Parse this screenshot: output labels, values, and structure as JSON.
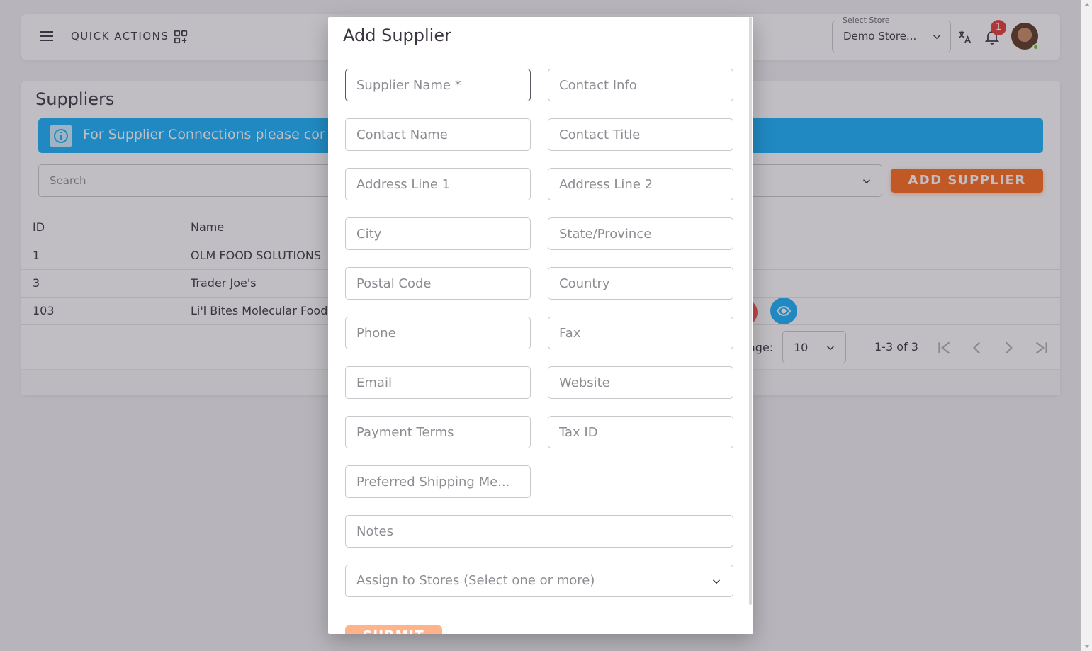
{
  "topbar": {
    "quick_actions_label": "QUICK ACTIONS",
    "store_select": {
      "label": "Select Store",
      "value": "Demo Store..."
    },
    "notification_count": "1"
  },
  "suppliers_page": {
    "title": "Suppliers",
    "alert_text": "For Supplier Connections please cor",
    "search_placeholder": "Search",
    "add_supplier_label": "ADD SUPPLIER",
    "columns": [
      "ID",
      "Name"
    ],
    "rows": [
      {
        "id": "1",
        "name": "OLM FOOD SOLUTIONS"
      },
      {
        "id": "3",
        "name": "Trader Joe's"
      },
      {
        "id": "103",
        "name": "Li'l Bites Molecular Food"
      }
    ],
    "pagination": {
      "rows_per_page_label": "age:",
      "rows_per_page_value": "10",
      "range": "1-3 of 3"
    }
  },
  "dialog": {
    "title": "Add Supplier",
    "fields": {
      "supplier_name": "Supplier Name *",
      "contact_info": "Contact Info",
      "contact_name": "Contact Name",
      "contact_title": "Contact Title",
      "address_line_1": "Address Line 1",
      "address_line_2": "Address Line 2",
      "city": "City",
      "state_province": "State/Province",
      "postal_code": "Postal Code",
      "country": "Country",
      "phone": "Phone",
      "fax": "Fax",
      "email": "Email",
      "website": "Website",
      "payment_terms": "Payment Terms",
      "tax_id": "Tax ID",
      "preferred_shipping": "Preferred Shipping Me...",
      "notes": "Notes",
      "assign_stores": "Assign to Stores (Select one or more)"
    },
    "submit_label": "SUBMIT"
  },
  "colors": {
    "primary": "#ff6b1a",
    "info": "#16b1ff",
    "error": "#ff4c51",
    "text": "#3a3541"
  }
}
